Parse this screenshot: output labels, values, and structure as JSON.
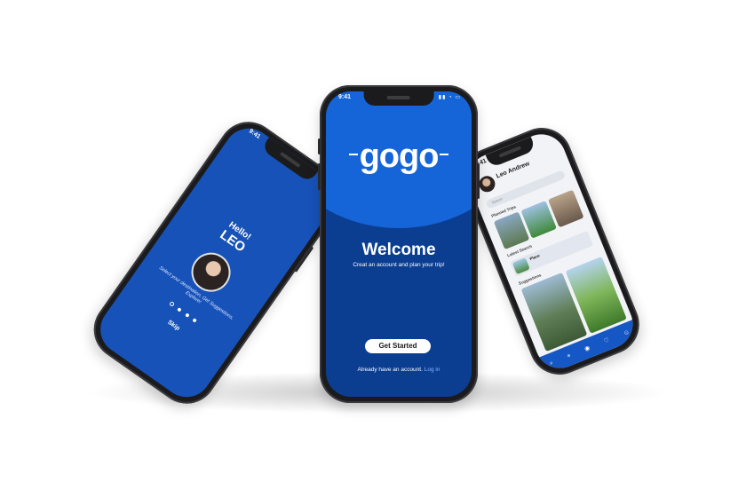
{
  "status_bar": {
    "time": "9:41"
  },
  "center_screen": {
    "logo_text": "gogo",
    "title": "Welcome",
    "subtitle": "Creat an account and plan your trip!",
    "get_started_label": "Get Started",
    "login_prompt": "Already have an account.",
    "login_link": "Log in"
  },
  "left_screen": {
    "greeting": "Hello!",
    "name": "LEO",
    "onboarding_text": "Select your destination, Get Suggestions, Explore!",
    "page_dots": 4,
    "active_dot": 1,
    "skip_label": "Skip"
  },
  "right_screen": {
    "user_name": "Leo Andrew",
    "search_placeholder": "Search",
    "section_popular": "Planned Trips",
    "section_latest": "Latest Search",
    "latest_item_title": "Place",
    "section_suggestions": "Suggestions"
  },
  "colors": {
    "brand_blue": "#1565d8",
    "dark_blue": "#0b3d91",
    "link_blue": "#8ab6ff"
  }
}
